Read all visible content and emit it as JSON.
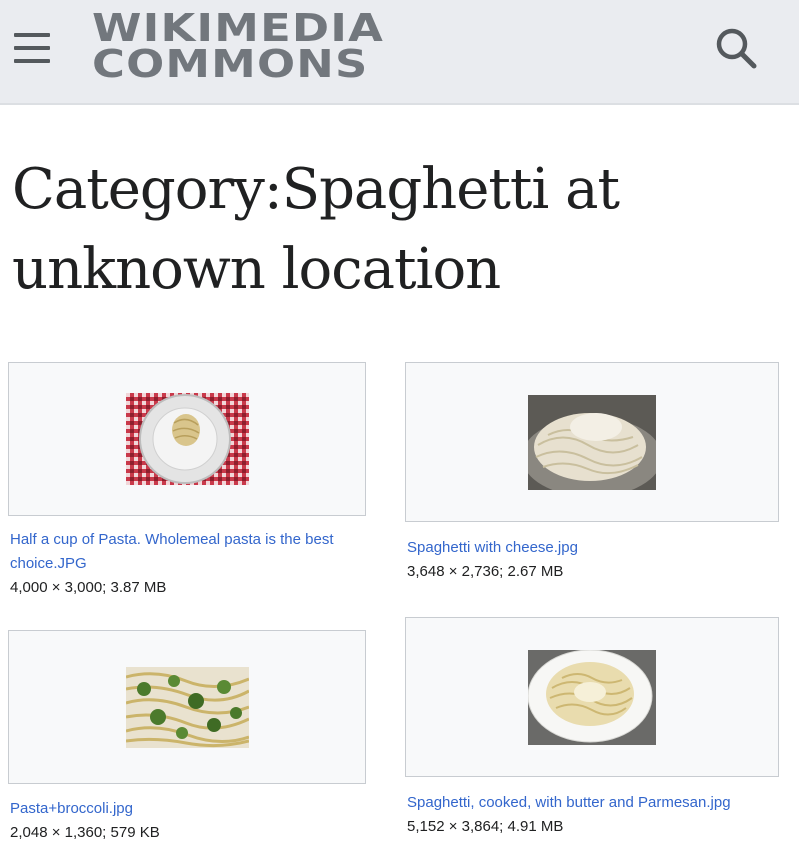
{
  "header": {
    "logo_line1": "WIKIMEDIA",
    "logo_line2": "COMMONS",
    "menu_icon": "hamburger-menu-icon",
    "search_icon": "search-icon",
    "background": "#eaecf0"
  },
  "page": {
    "title": "Category:Spaghetti at unknown location"
  },
  "gallery": [
    {
      "file": "Half a cup of Pasta. Wholemeal pasta is the best choice.JPG",
      "meta": "4,000 × 3,000; 3.87 MB"
    },
    {
      "file": "Spaghetti with cheese.jpg",
      "meta": "3,648 × 2,736; 2.67 MB"
    },
    {
      "file": "Pasta+broccoli.jpg",
      "meta": "2,048 × 1,360; 579 KB"
    },
    {
      "file": "Spaghetti, cooked, with butter and Parmesan.jpg",
      "meta": "5,152 × 3,864; 4.91 MB"
    }
  ],
  "colors": {
    "link": "#3366cc",
    "text": "#202122",
    "logo": "#72777d"
  }
}
